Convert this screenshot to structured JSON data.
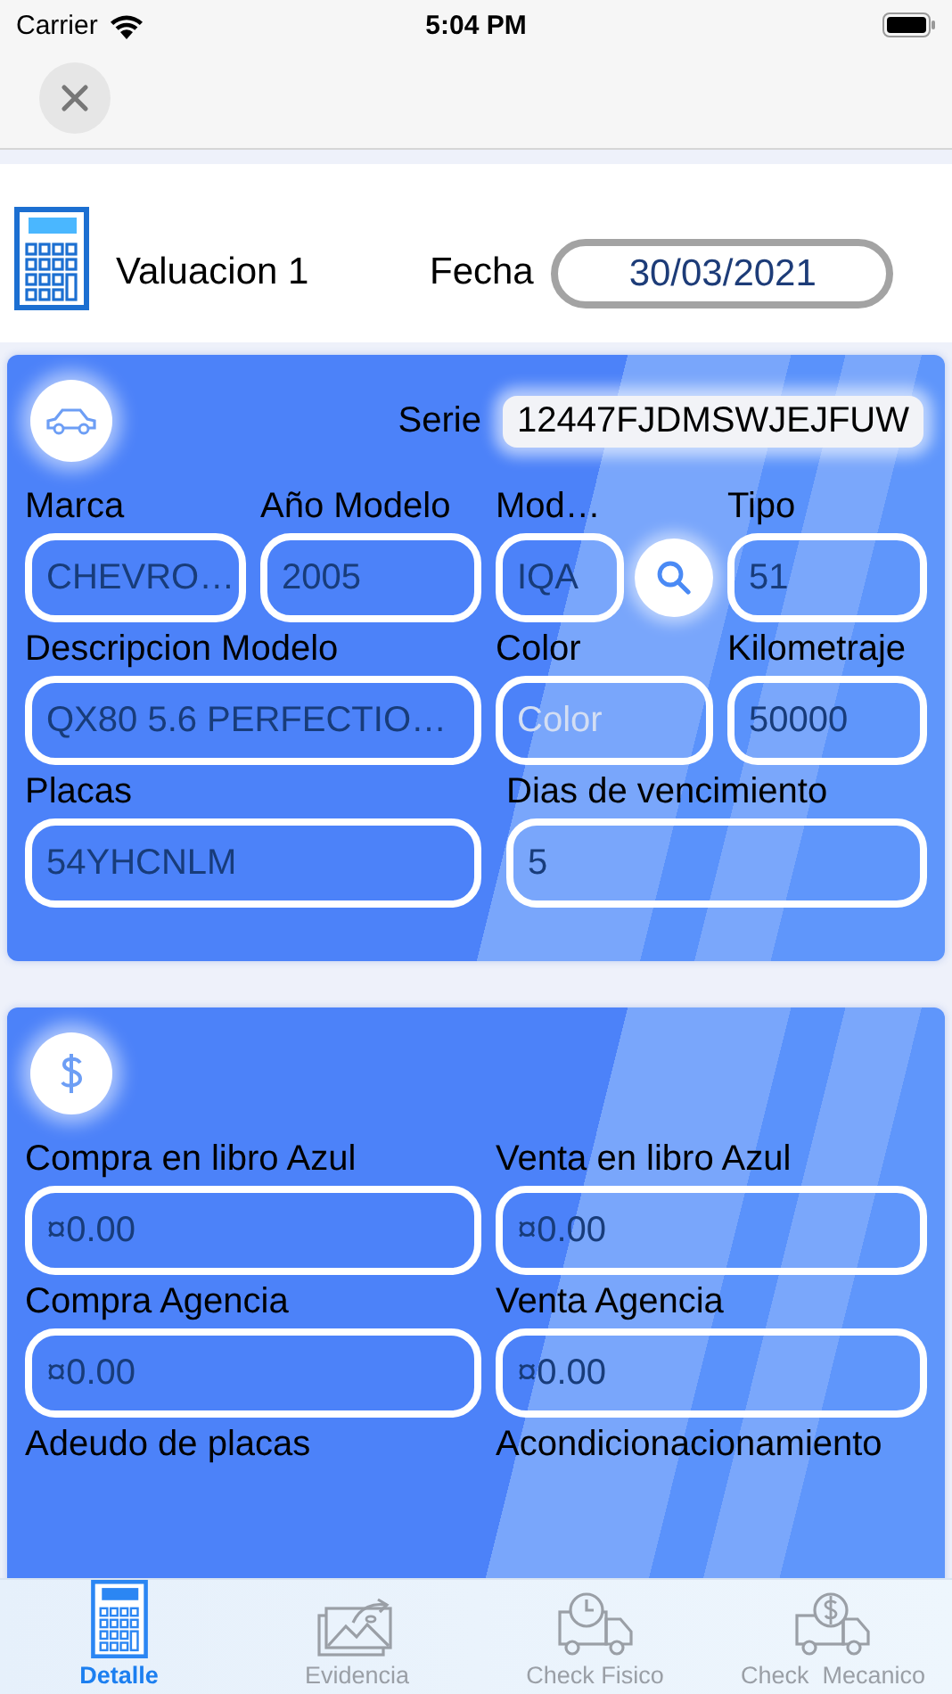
{
  "status_bar": {
    "carrier": "Carrier",
    "time": "5:04 PM"
  },
  "header": {
    "title": "Valuacion 1",
    "date_label": "Fecha",
    "date_value": "30/03/2021"
  },
  "vehicle_card": {
    "serie_label": "Serie",
    "serie_value": "12447FJDMSWJEJFUW",
    "fields": [
      {
        "label": "Marca",
        "value": "CHEVRO…"
      },
      {
        "label": "Año Modelo",
        "value": "2005"
      },
      {
        "label": "Mod…",
        "value": "IQA",
        "kind": "lookup"
      },
      {
        "label": "Tipo",
        "value": "51"
      },
      {
        "label": "Descripcion Modelo",
        "value": "QX80 5.6 PERFECTIO…"
      },
      {
        "label": "Color",
        "placeholder": "Color"
      },
      {
        "label": "Kilometraje",
        "value": "50000"
      },
      {
        "label": "Placas",
        "value": "54YHCNLM"
      },
      {
        "label": "Dias de vencimiento",
        "value": "5"
      }
    ]
  },
  "price_card": {
    "fields": [
      {
        "label": "Compra en libro Azul",
        "value": "¤0.00"
      },
      {
        "label": "Venta en libro Azul",
        "value": "¤0.00"
      },
      {
        "label": "Compra Agencia",
        "value": "¤0.00"
      },
      {
        "label": "Venta Agencia",
        "value": "¤0.00"
      },
      {
        "label": "Adeudo de placas"
      },
      {
        "label": "Acondicionacionamiento"
      }
    ]
  },
  "tab_bar": [
    {
      "label": "Detalle",
      "selected": true
    },
    {
      "label": "Evidencia",
      "selected": false
    },
    {
      "label": "Check Fisico",
      "selected": false
    },
    {
      "label": "Check  Mecanico",
      "selected": false
    }
  ]
}
